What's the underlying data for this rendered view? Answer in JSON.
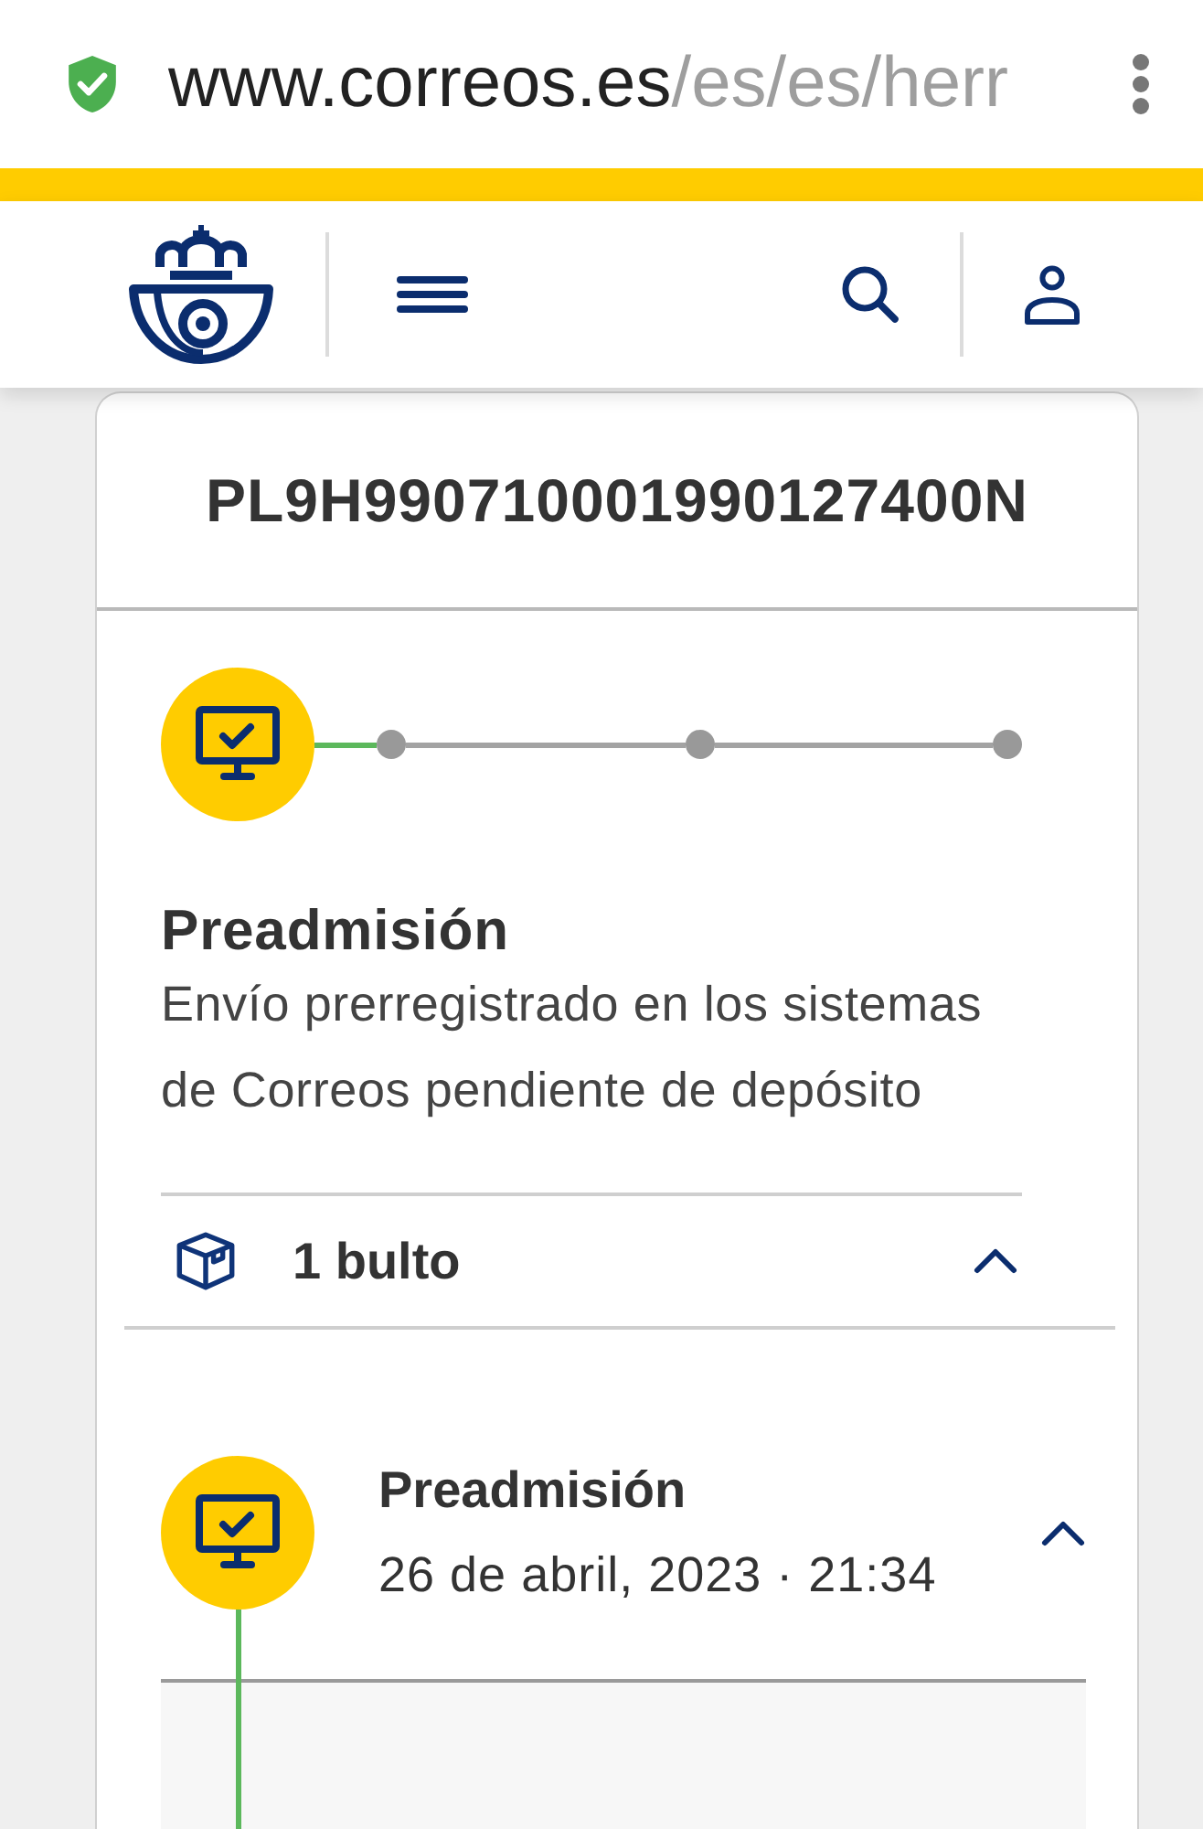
{
  "browser": {
    "secure": true,
    "url_host": "www.correos.es",
    "url_path": "/es/es/herr"
  },
  "shipment": {
    "tracking_number": "PL9H990710001990127400N",
    "steps": [
      {
        "completed": true
      },
      {
        "completed": false
      },
      {
        "completed": false
      },
      {
        "completed": false
      }
    ],
    "status_title": "Preadmisión",
    "status_description": "Envío prerregistrado en los sistemas de Correos pendiente de depósito",
    "packages": {
      "label": "1 bulto",
      "expanded": true
    }
  },
  "events": [
    {
      "title": "Preadmisión",
      "datetime": "26 de abril, 2023 · 21:34",
      "expanded": true
    }
  ]
}
